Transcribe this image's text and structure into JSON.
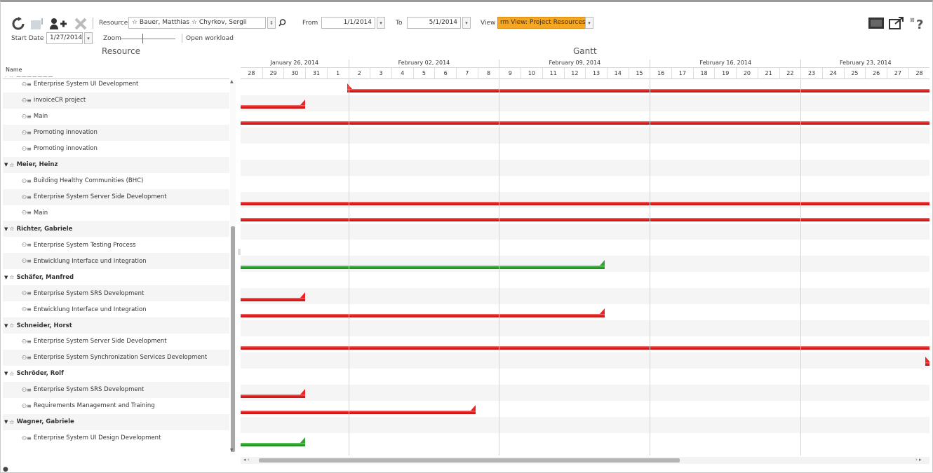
{
  "toolbar": {
    "resource_label": "Resource",
    "resource_value": "☆ Bauer, Matthias  ☆ Chyrkov, Sergii",
    "from_label": "From",
    "from_value": "1/1/2014",
    "to_label": "To",
    "to_value": "5/1/2014",
    "view_label": "View",
    "view_value": "rm View: Project Resources",
    "start_date_label": "Start Date",
    "start_date_value": "1/27/2014",
    "zoom_label": "Zoom",
    "open_workload": "Open workload"
  },
  "panels": {
    "resource_title": "Resource",
    "gantt_title": "Gantt",
    "name_header": "Name"
  },
  "weeks": [
    "January 26, 2014",
    "February 02, 2014",
    "February 09, 2014",
    "February 16, 2014",
    "February 23, 2014"
  ],
  "days": [
    "28",
    "29",
    "30",
    "31",
    "1",
    "2",
    "3",
    "4",
    "5",
    "6",
    "7",
    "8",
    "9",
    "10",
    "11",
    "12",
    "13",
    "14",
    "15",
    "16",
    "17",
    "18",
    "19",
    "20",
    "21",
    "22",
    "23",
    "24",
    "25",
    "26",
    "27",
    "28"
  ],
  "rows": [
    {
      "type": "task",
      "label": "Enterprise System UI Development"
    },
    {
      "type": "task",
      "label": "invoiceCR project"
    },
    {
      "type": "task",
      "label": "Main"
    },
    {
      "type": "task",
      "label": "Promoting innovation"
    },
    {
      "type": "task",
      "label": "Promoting innovation"
    },
    {
      "type": "group",
      "label": "Meier, Heinz"
    },
    {
      "type": "task",
      "label": "Building Healthy Communities (BHC)"
    },
    {
      "type": "task",
      "label": "Enterprise System Server Side Development"
    },
    {
      "type": "task",
      "label": "Main"
    },
    {
      "type": "group",
      "label": "Richter, Gabriele"
    },
    {
      "type": "task",
      "label": "Enterprise System Testing Process"
    },
    {
      "type": "task",
      "label": "Entwicklung Interface und Integration"
    },
    {
      "type": "group",
      "label": "Schäfer, Manfred"
    },
    {
      "type": "task",
      "label": "Enterprise System SRS Development"
    },
    {
      "type": "task",
      "label": "Entwicklung Interface und Integration"
    },
    {
      "type": "group",
      "label": "Schneider, Horst"
    },
    {
      "type": "task",
      "label": "Enterprise System Server Side Development"
    },
    {
      "type": "task",
      "label": "Enterprise System Synchronization Services Development"
    },
    {
      "type": "group",
      "label": "Schröder, Rolf"
    },
    {
      "type": "task",
      "label": "Enterprise System SRS Development"
    },
    {
      "type": "task",
      "label": "Requirements Management and Training"
    },
    {
      "type": "group",
      "label": "Wagner, Gabriele"
    },
    {
      "type": "task",
      "label": "Enterprise System UI Design Development"
    }
  ],
  "colors": {
    "bar_red": "#e21f1f",
    "bar_green": "#2ea52e",
    "view_highlight": "#f5a623"
  }
}
